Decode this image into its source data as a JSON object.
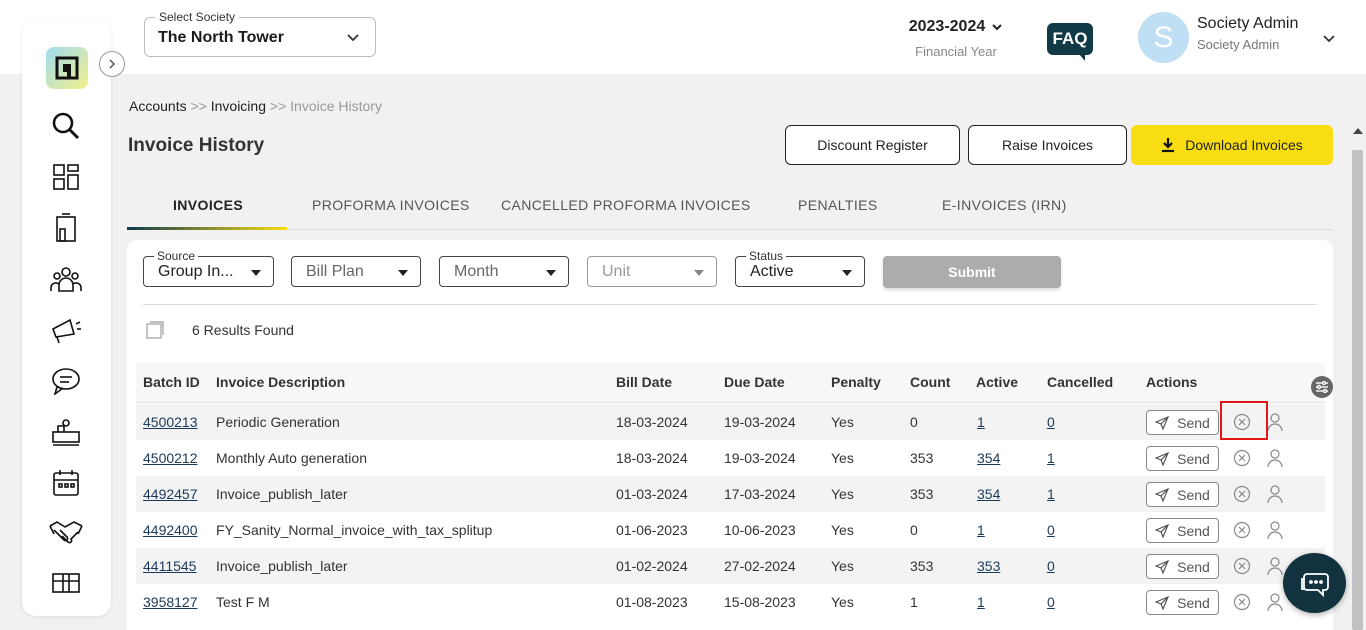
{
  "header": {
    "society_legend": "Select Society",
    "society_value": "The North Tower",
    "financial_year": "2023-2024",
    "financial_year_label": "Financial Year",
    "faq_label": "FAQ",
    "avatar_initial": "S",
    "user_name": "Society Admin",
    "user_role": "Society Admin"
  },
  "sidebar": {
    "items": [
      "search-icon",
      "dashboard-icon",
      "building-icon",
      "people-icon",
      "megaphone-icon",
      "chat-icon",
      "facility-icon",
      "calendar-icon",
      "handshake-icon",
      "box-icon"
    ]
  },
  "breadcrumb": {
    "level1": "Accounts",
    "sep1": " >> ",
    "level2": "Invoicing",
    "sep2": " >> ",
    "level3": "Invoice History"
  },
  "page": {
    "title": "Invoice History",
    "discount_register_label": "Discount Register",
    "raise_invoices_label": "Raise Invoices",
    "download_invoices_label": "Download Invoices"
  },
  "tabs": [
    "INVOICES",
    "PROFORMA INVOICES",
    "CANCELLED PROFORMA INVOICES",
    "PENALTIES",
    "E-INVOICES (IRN)"
  ],
  "filters": {
    "source_legend": "Source",
    "source_value": "Group In...",
    "bill_plan_placeholder": "Bill Plan",
    "month_placeholder": "Month",
    "unit_placeholder": "Unit",
    "status_legend": "Status",
    "status_value": "Active",
    "submit_label": "Submit"
  },
  "results_count": "6 Results Found",
  "table": {
    "headers": [
      "Batch ID",
      "Invoice Description",
      "Bill Date",
      "Due Date",
      "Penalty",
      "Count",
      "Active",
      "Cancelled",
      "Actions"
    ],
    "send_label": "Send",
    "rows": [
      {
        "batch_id": "4500213",
        "description": "Periodic Generation",
        "bill_date": "18-03-2024",
        "due_date": "19-03-2024",
        "penalty": "Yes",
        "count": "0",
        "active": "1",
        "cancelled": "0"
      },
      {
        "batch_id": "4500212",
        "description": "Monthly Auto generation",
        "bill_date": "18-03-2024",
        "due_date": "19-03-2024",
        "penalty": "Yes",
        "count": "353",
        "active": "354",
        "cancelled": "1"
      },
      {
        "batch_id": "4492457",
        "description": "Invoice_publish_later",
        "bill_date": "01-03-2024",
        "due_date": "17-03-2024",
        "penalty": "Yes",
        "count": "353",
        "active": "354",
        "cancelled": "1"
      },
      {
        "batch_id": "4492400",
        "description": "FY_Sanity_Normal_invoice_with_tax_splitup",
        "bill_date": "01-06-2023",
        "due_date": "10-06-2023",
        "penalty": "Yes",
        "count": "0",
        "active": "1",
        "cancelled": "0"
      },
      {
        "batch_id": "4411545",
        "description": "Invoice_publish_later",
        "bill_date": "01-02-2024",
        "due_date": "27-02-2024",
        "penalty": "Yes",
        "count": "353",
        "active": "353",
        "cancelled": "0"
      },
      {
        "batch_id": "3958127",
        "description": "Test F M",
        "bill_date": "01-08-2023",
        "due_date": "15-08-2023",
        "penalty": "Yes",
        "count": "1",
        "active": "1",
        "cancelled": "0"
      }
    ]
  },
  "colors": {
    "accent_yellow": "#f8dd12",
    "brand_dark": "#103a46",
    "highlight_red": "#e01818"
  }
}
